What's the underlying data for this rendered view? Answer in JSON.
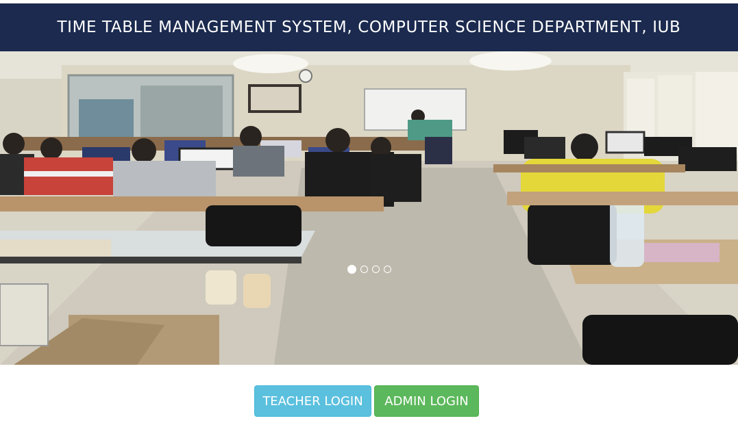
{
  "header": {
    "title": "TIME TABLE MANAGEMENT SYSTEM, COMPUTER SCIENCE DEPARTMENT, IUB"
  },
  "carousel": {
    "slide_count": 4,
    "active_index": 0,
    "image_description_icon": "computer-lab-photo"
  },
  "buttons": {
    "teacher_login": "TEACHER LOGIN",
    "admin_login": "ADMIN LOGIN"
  },
  "colors": {
    "header_bg": "#1b2a4e",
    "teacher_btn": "#5bc0de",
    "admin_btn": "#5cb85c"
  }
}
